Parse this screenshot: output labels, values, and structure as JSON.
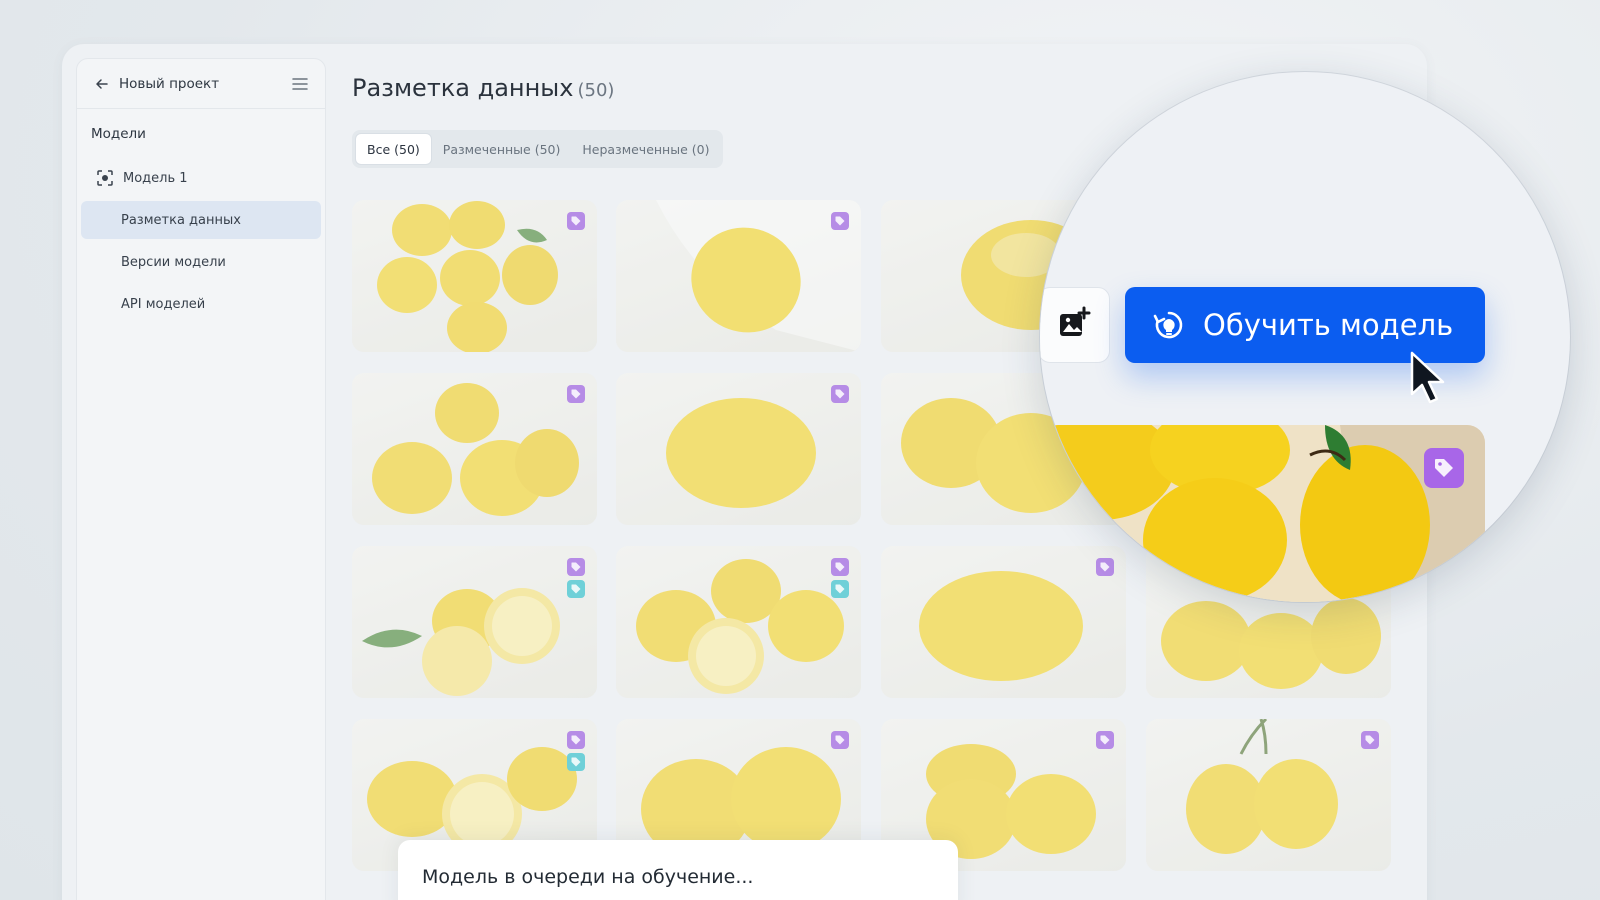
{
  "sidebar": {
    "project_title": "Новый проект",
    "section_label": "Модели",
    "items": [
      {
        "label": "Модель 1"
      },
      {
        "label": "Разметка данных"
      },
      {
        "label": "Версии модели"
      },
      {
        "label": "API моделей"
      }
    ]
  },
  "main": {
    "title": "Разметка данных",
    "title_count": "(50)",
    "tabs": [
      {
        "label": "Все (50)"
      },
      {
        "label": "Размеченные (50)"
      },
      {
        "label": "Неразмеченные (0)"
      }
    ]
  },
  "toolbar": {
    "train_label": "Обучить модель"
  },
  "toast": {
    "message": "Модель в очереди на обучение..."
  },
  "colors": {
    "accent": "#0b5df0",
    "tag_purple": "#b68ce6",
    "tag_teal": "#6fd0d8",
    "active_item": "#dde6f2"
  },
  "icons": [
    "back-arrow-icon",
    "menu-icon",
    "model-scan-icon",
    "tag-icon",
    "add-image-icon",
    "train-icon",
    "cursor-icon"
  ]
}
